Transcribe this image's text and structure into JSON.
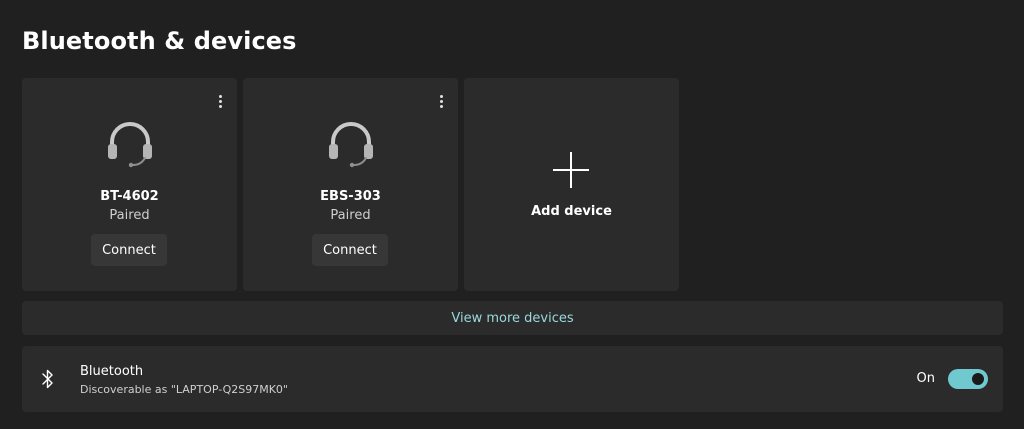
{
  "page": {
    "title": "Bluetooth & devices"
  },
  "devices": [
    {
      "name": "BT-4602",
      "status": "Paired",
      "action": "Connect",
      "icon": "headset-icon"
    },
    {
      "name": "EBS-303",
      "status": "Paired",
      "action": "Connect",
      "icon": "headset-icon"
    }
  ],
  "add_device": {
    "label": "Add device",
    "icon": "plus-icon"
  },
  "view_more": {
    "label": "View more devices"
  },
  "bluetooth": {
    "title": "Bluetooth",
    "subtitle": "Discoverable as \"LAPTOP-Q2S97MK0\"",
    "state_label": "On",
    "enabled": true,
    "icon": "bluetooth-icon"
  },
  "colors": {
    "background": "#202020",
    "card": "#2b2b2b",
    "button": "#373737",
    "accent": "#6fc9cf",
    "link": "#9ad8dc"
  }
}
